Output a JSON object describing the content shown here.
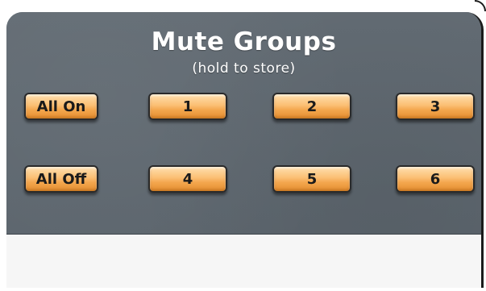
{
  "panel": {
    "title": "Mute Groups",
    "subtitle": "(hold to store)"
  },
  "buttons": {
    "all_on": "All On",
    "all_off": "All Off",
    "group_1": "1",
    "group_2": "2",
    "group_3": "3",
    "group_4": "4",
    "group_5": "5",
    "group_6": "6"
  },
  "colors": {
    "panel": "#5b646c",
    "button": "#f3a64d",
    "button_text": "#1a1a1a",
    "title_text": "#ffffff",
    "bottom_area": "#f6f6f6"
  }
}
